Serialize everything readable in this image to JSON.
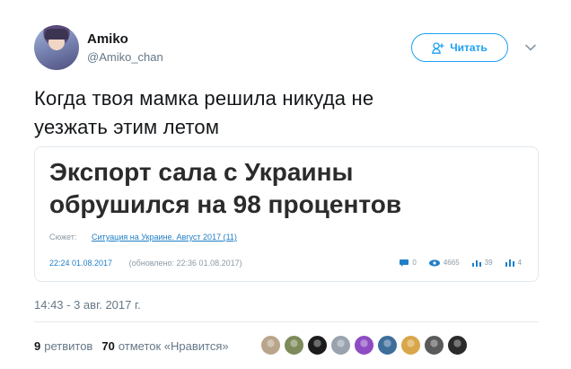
{
  "user": {
    "name": "Amiko",
    "handle": "@Amiko_chan"
  },
  "follow_button": {
    "label": "Читать",
    "icon": "add-person-icon"
  },
  "tweet": {
    "text_line1": "Когда твоя мамка решила никуда не",
    "text_line2": "уезжать этим летом"
  },
  "card": {
    "title_line1": "Экспорт сала с Украины",
    "title_line2": "обрушился на 98 процентов",
    "story_label": "Сюжет:",
    "story_link": "Ситуация на Украине. Август 2017 (11)",
    "published": "22:24 01.08.2017",
    "updated": "(обновлено: 22:36 01.08.2017)",
    "stats": {
      "comments": "0",
      "views": "4665",
      "likes": "39",
      "shares": "4"
    }
  },
  "footer": {
    "timestamp": "14:43 - 3 авг. 2017 г.",
    "retweets_count": "9",
    "retweets_label": "ретвитов",
    "likes_count": "70",
    "likes_label": "отметок «Нравится»"
  },
  "colors": {
    "accent": "#1da1f2",
    "text": "#14171a",
    "muted": "#657786"
  },
  "liker_avatars": [
    "#b9a58c",
    "#7d8a5a",
    "#1c1c1c",
    "#9aa3ad",
    "#8e4cc2",
    "#3e6e9a",
    "#d9a64a",
    "#5a5a5a",
    "#2b2b2b"
  ]
}
